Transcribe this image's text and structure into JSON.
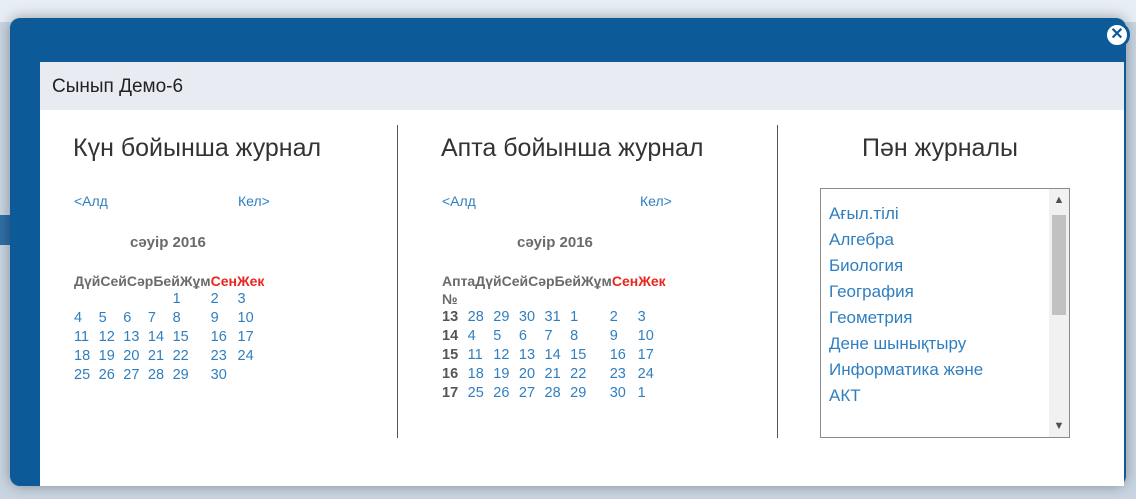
{
  "modal": {
    "title": "Сынып Демо-6",
    "close_icon": "close-icon"
  },
  "day_journal": {
    "title": "Күн бойынша журнал",
    "prev": "<Алд",
    "next": "Кел>",
    "month": "сәуір 2016",
    "weekday_headers": [
      "Дүй",
      "Сей",
      "Сәр",
      "Бей",
      "Жұм",
      "Сен",
      "Жек"
    ],
    "weeks": [
      [
        "",
        "",
        "",
        "",
        "1",
        "2",
        "3"
      ],
      [
        "4",
        "5",
        "6",
        "7",
        "8",
        "9",
        "10"
      ],
      [
        "11",
        "12",
        "13",
        "14",
        "15",
        "16",
        "17"
      ],
      [
        "18",
        "19",
        "20",
        "21",
        "22",
        "23",
        "24"
      ],
      [
        "25",
        "26",
        "27",
        "28",
        "29",
        "30",
        ""
      ]
    ]
  },
  "week_journal": {
    "title": "Апта бойынша журнал",
    "prev": "<Алд",
    "next": "Кел>",
    "month": "сәуір 2016",
    "week_header": "Апта",
    "week_number_label": "№",
    "weekday_headers": [
      "Дүй",
      "Сей",
      "Сәр",
      "Бей",
      "Жұм",
      "Сен",
      "Жек"
    ],
    "weeks": [
      {
        "no": "13",
        "days": [
          "28",
          "29",
          "30",
          "31",
          "1",
          "2",
          "3"
        ]
      },
      {
        "no": "14",
        "days": [
          "4",
          "5",
          "6",
          "7",
          "8",
          "9",
          "10"
        ]
      },
      {
        "no": "15",
        "days": [
          "11",
          "12",
          "13",
          "14",
          "15",
          "16",
          "17"
        ]
      },
      {
        "no": "16",
        "days": [
          "18",
          "19",
          "20",
          "21",
          "22",
          "23",
          "24"
        ]
      },
      {
        "no": "17",
        "days": [
          "25",
          "26",
          "27",
          "28",
          "29",
          "30",
          "1"
        ]
      }
    ]
  },
  "subject_journal": {
    "title": "Пән журналы",
    "items": [
      "Ағыл.тілі",
      "Алгебра",
      "Биология",
      "География",
      "Геометрия",
      "Дене шынықтыру",
      "Информатика және",
      "АКТ"
    ]
  },
  "colors": {
    "frame": "#0d5a99",
    "link": "#2f7fc0",
    "weekend": "#e8261e"
  }
}
